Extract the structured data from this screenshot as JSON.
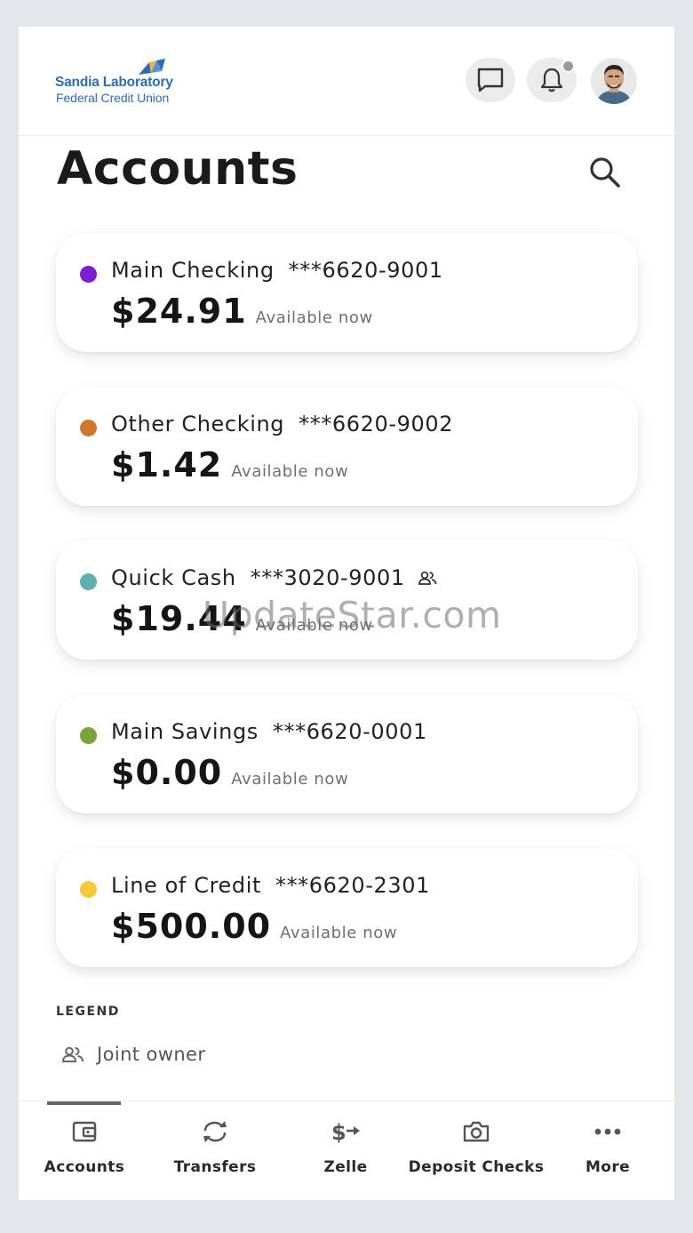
{
  "header": {
    "brand_line1": "Sandia Laboratory",
    "brand_line2": "Federal Credit Union",
    "brand_color": "#2e6db4"
  },
  "page": {
    "title": "Accounts"
  },
  "accounts": [
    {
      "name": "Main Checking",
      "number": "***6620-9001",
      "balance": "$24.91",
      "status": "Available now",
      "color": "#7b1fd0",
      "joint": false
    },
    {
      "name": "Other Checking",
      "number": "***6620-9002",
      "balance": "$1.42",
      "status": "Available now",
      "color": "#d2762e",
      "joint": false
    },
    {
      "name": "Quick Cash",
      "number": "***3020-9001",
      "balance": "$19.44",
      "status": "Available now",
      "color": "#5fb0ad",
      "joint": true
    },
    {
      "name": "Main Savings",
      "number": "***6620-0001",
      "balance": "$0.00",
      "status": "Available now",
      "color": "#7aa33c",
      "joint": false
    },
    {
      "name": "Line of Credit",
      "number": "***6620-2301",
      "balance": "$500.00",
      "status": "Available now",
      "color": "#f5c93a",
      "joint": false
    }
  ],
  "legend": {
    "title": "LEGEND",
    "items": [
      {
        "icon": "joint-owner-icon",
        "label": "Joint owner"
      }
    ]
  },
  "watermark": "UpdateStar.com",
  "nav": [
    {
      "label": "Accounts",
      "icon": "wallet-icon",
      "active": true
    },
    {
      "label": "Transfers",
      "icon": "transfer-icon",
      "active": false
    },
    {
      "label": "Zelle",
      "icon": "zelle-icon",
      "active": false
    },
    {
      "label": "Deposit Checks",
      "icon": "camera-icon",
      "active": false
    },
    {
      "label": "More",
      "icon": "more-icon",
      "active": false
    }
  ]
}
